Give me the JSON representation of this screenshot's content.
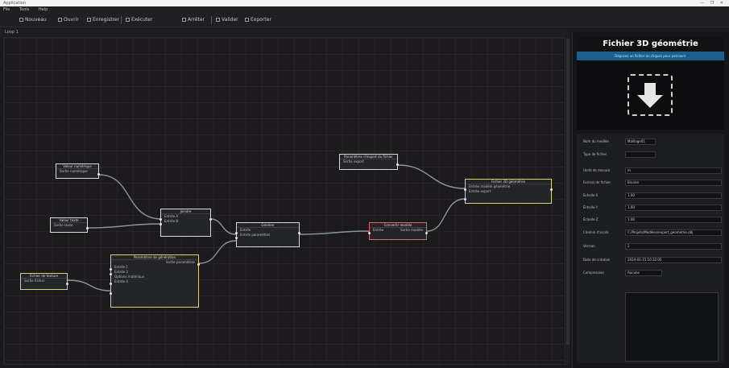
{
  "window": {
    "title": "Application",
    "controls": "— ❐ ✕"
  },
  "menu": [
    "File",
    "Tools",
    "Help"
  ],
  "toolbar": {
    "items": [
      "Nouveau",
      "Ouvrir",
      "Enregistrer",
      "Exécuter",
      "Arrêter",
      "Valider",
      "Exporter"
    ]
  },
  "subbar": {
    "label": "Loop 1"
  },
  "nodes": {
    "n1": {
      "title": "Valeur numérique",
      "rows": [
        "Sortie numérique"
      ]
    },
    "n2": {
      "title": "Valeur texte",
      "rows": [
        "Sortie texte"
      ]
    },
    "n3": {
      "title": "Fichier de texture",
      "rows": [
        "Sortie fichier"
      ]
    },
    "n4": {
      "title": "Joindre",
      "rows": [
        "Entrée A",
        "Entrée B"
      ]
    },
    "n5": {
      "title": "Paramètres de génération",
      "rows": [
        "Sortie paramètres",
        "Entrée 1",
        "Entrée 2",
        "Options matériaux",
        "Entrée 4"
      ]
    },
    "n6": {
      "title": "Générer",
      "rows": [
        "Entrée",
        "Entrée paramètres"
      ]
    },
    "n7": {
      "title": "Paramètres d'export du fichier",
      "rows": [
        "Sortie export"
      ]
    },
    "n8": {
      "title": "Convertir modèle",
      "rows": [
        "Entrée",
        "Sortie modèle"
      ]
    },
    "n9": {
      "title": "Fichier 3D géométrie",
      "rows": [
        "Entrée modèle géométrie",
        "Entrée export"
      ]
    }
  },
  "panel": {
    "title": "Fichier 3D géométrie",
    "status": "Déposez un fichier ou cliquez pour parcourir",
    "properties": [
      {
        "label": "Nom du modèle",
        "value": "Maillage01"
      },
      {
        "label": "Type de fichier",
        "value": ""
      },
      {
        "label": "Unité de mesure",
        "value": "m"
      },
      {
        "label": "Format de fichier",
        "value": "Binaire"
      },
      {
        "label": "Échelle X",
        "value": "1.00"
      },
      {
        "label": "Échelle Y",
        "value": "1.00"
      },
      {
        "label": "Échelle Z",
        "value": "1.00"
      },
      {
        "label": "Chemin d'accès",
        "value": "C:/Projets/Modèles/export_geometrie.obj"
      },
      {
        "label": "Version",
        "value": "2"
      },
      {
        "label": "Date de création",
        "value": "2024-01-15 10:32:05"
      },
      {
        "label": "Compression",
        "value": "Aucune"
      }
    ]
  }
}
